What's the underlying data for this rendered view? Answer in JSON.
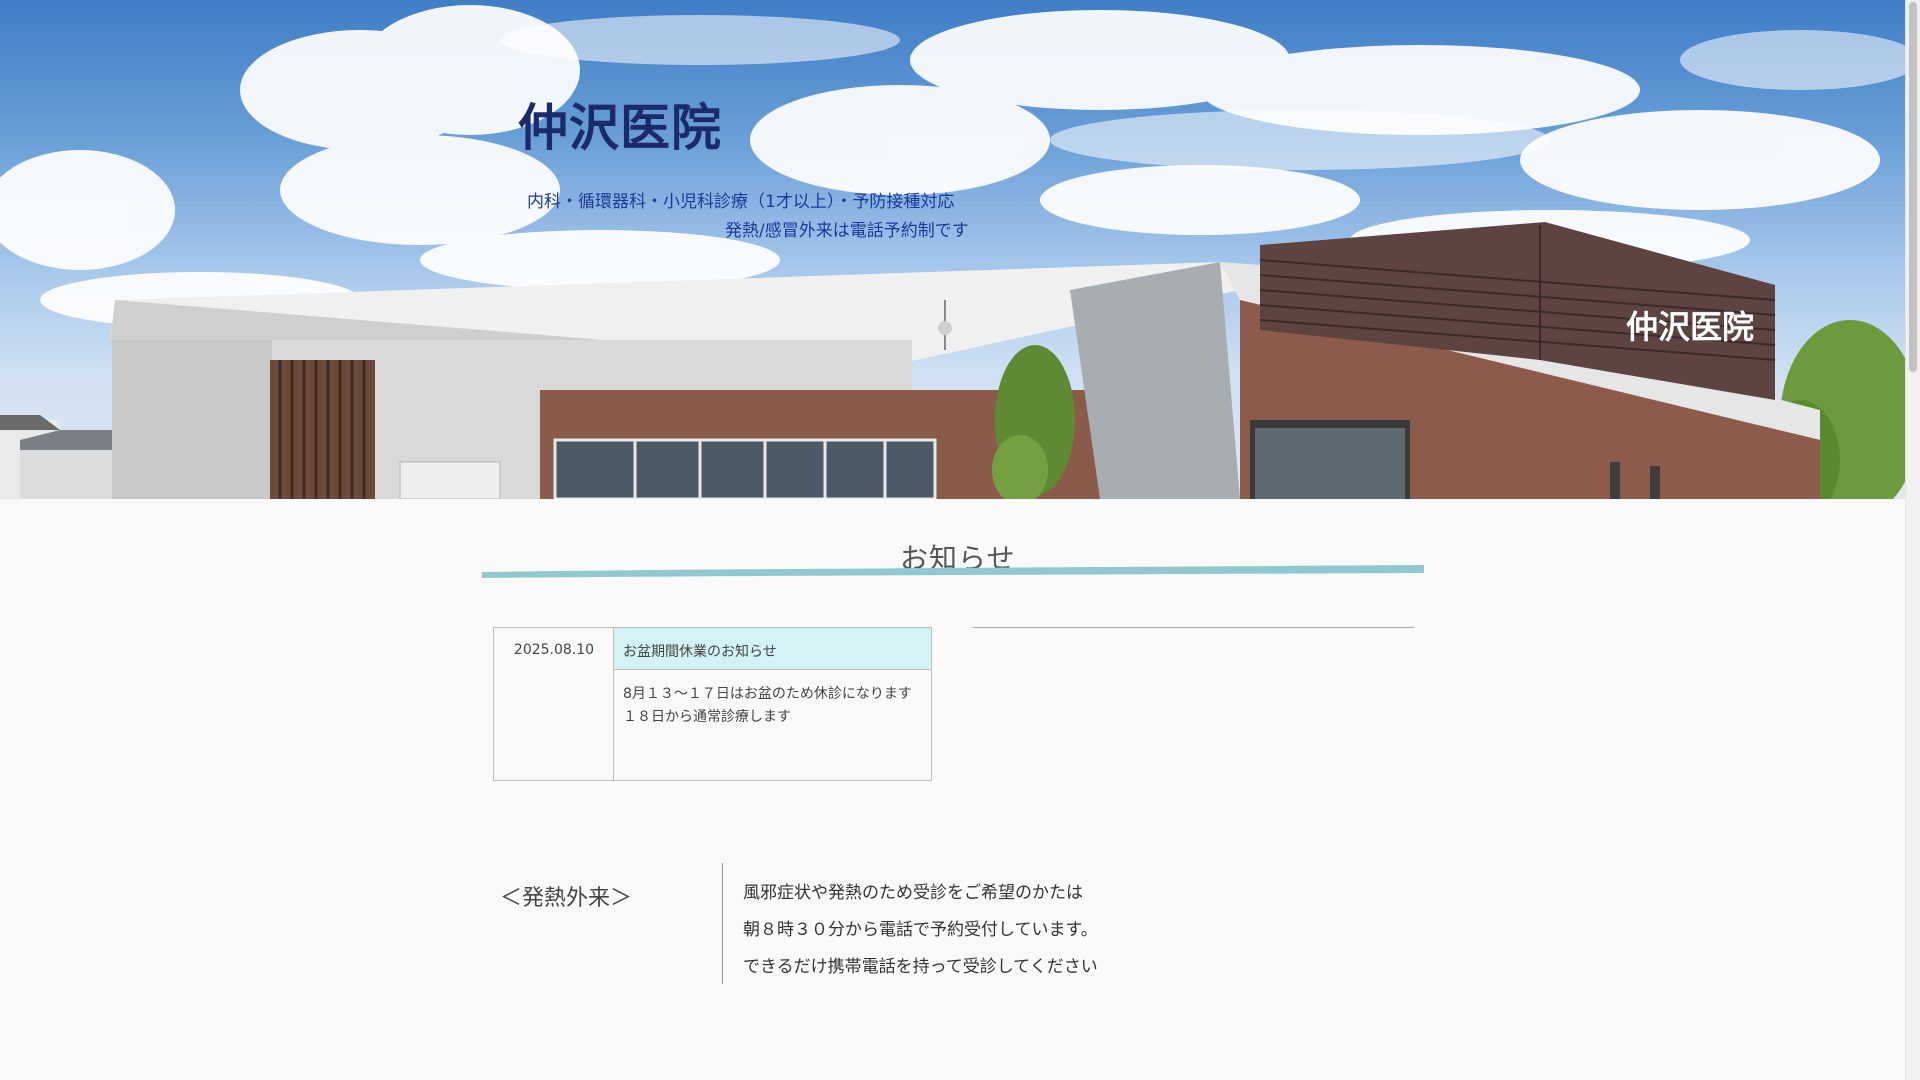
{
  "header": {
    "site_title": "仲沢医院",
    "tagline_line1": "内科・循環器科・小児科診療（1才以上）・予防接種対応",
    "tagline_line2": "発熱/感冒外来は電話予約制です",
    "building_sign": "仲沢医院"
  },
  "news": {
    "heading": "お知らせ",
    "items": [
      {
        "date": "2025.08.10",
        "title": "お盆期間休業のお知らせ",
        "body_line1": "8月１３～１７日はお盆のため休診になります",
        "body_line2": "１８日から通常診療します"
      }
    ]
  },
  "fever_clinic": {
    "label": "＜発熱外来＞",
    "line1": "風邪症状や発熱のため受診をご希望のかたは",
    "line2": "朝８時３０分から電話で予約受付しています。",
    "line3": "できるだけ携帯電話を持って受診してください"
  },
  "colors": {
    "title": "#1a2a6a",
    "tagline": "#1a3a9a",
    "news_title_bg": "#d4f1f6",
    "heading_underline": "#8fc9cf"
  }
}
